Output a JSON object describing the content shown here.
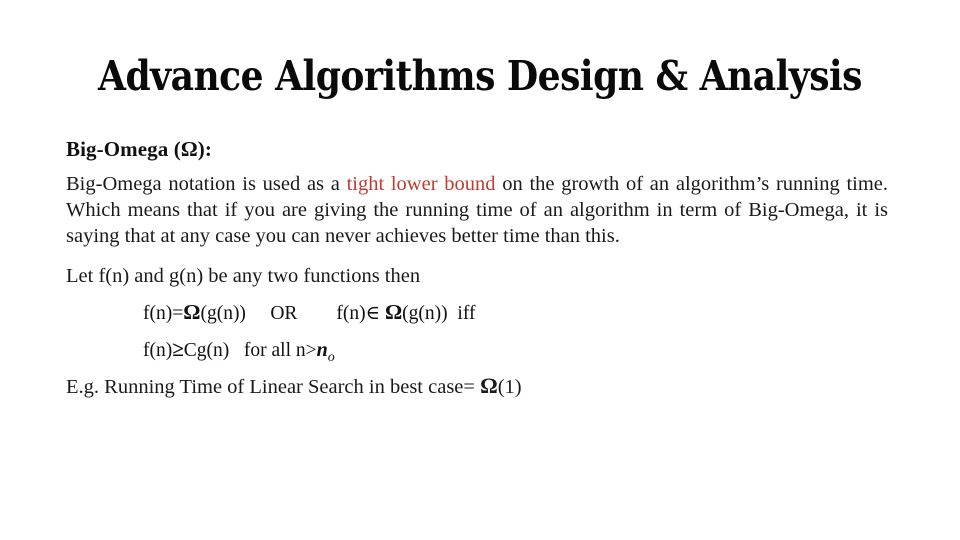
{
  "slide": {
    "title": "Advance Algorithms Design & Analysis",
    "heading": "Big-Omega (Ω):",
    "paragraph": {
      "part1": "Big-Omega notation is used as a ",
      "highlight": "tight lower bound",
      "part2": " on the growth of an algorithm’s running time. Which means that if you are giving the running time of an algorithm in term of Big-Omega, it is saying that at any case you can never achieves better time than this."
    },
    "lead_line": "Let f(n) and g(n) be any two functions then",
    "formula_line_1": {
      "lhs": "f(n)=",
      "omega_1": "Ω",
      "arg_1": "(g(n))",
      "connector": "OR",
      "rhs": "f(n)∈ ",
      "omega_2": "Ω",
      "arg_2": "(g(n))",
      "suffix": "iff"
    },
    "formula_line_2": {
      "lhs": "f(n)",
      "ge": "≥",
      "mid": "Cg(n)",
      "condition": "for all n>",
      "var": "n",
      "subscript": "o"
    },
    "example": {
      "text": "E.g. Running Time of Linear Search in best case= ",
      "omega": "Ω",
      "arg": "(1)"
    },
    "colors": {
      "highlight_red": "#bf3b30",
      "text_black": "#1a1a1a",
      "background": "#ffffff"
    }
  }
}
